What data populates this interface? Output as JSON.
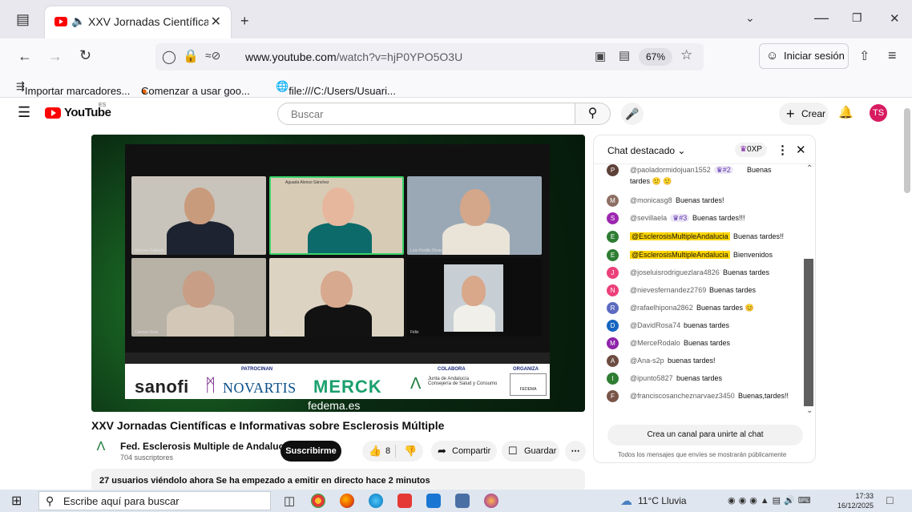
{
  "browser": {
    "tab_title": "XXV Jornadas Científicas e I",
    "url_host": "www.youtube.com",
    "url_path": "/watch?v=hjP0YPO5O3U",
    "zoom": "67%",
    "signin_label": "Iniciar sesión",
    "bookmarks": [
      "Importar marcadores...",
      "Comenzar a usar goo...",
      "file:///C:/Users/Usuari..."
    ]
  },
  "youtube": {
    "logo_text": "YouTube",
    "region": "ES",
    "search_placeholder": "Buscar",
    "create_label": "Crear",
    "avatar_initials": "TS"
  },
  "video": {
    "participants": [
      "Antonio Gallardo",
      "Aguada Alonso Sánchez",
      "Luis Portillo Rivas",
      "Carmen Ruiz",
      "ivonne",
      "Félix"
    ],
    "sponsor_labels": {
      "patrocinan": "PATROCINAN",
      "colabora": "COLABORA",
      "organiza": "ORGANIZA"
    },
    "sponsors": [
      "sanofi",
      "NOVARTIS",
      "MERCK"
    ],
    "junta_text": "Junta de Andalucía",
    "junta_sub": "Consejería de Salud y Consumo",
    "fedema_logo": "FEDEMA",
    "url_banner": "fedema.es"
  },
  "meta": {
    "title": "XXV Jornadas Científicas e Informativas sobre Esclerosis Múltiple",
    "channel": "Fed. Esclerosis Multiple de Andalucia",
    "subscribers": "704 suscriptores",
    "subscribe_label": "Suscribirme",
    "likes": "8",
    "share_label": "Compartir",
    "save_label": "Guardar",
    "info": "27 usuarios viéndolo ahora  Se ha empezado a emitir en directo hace 2 minutos"
  },
  "chat": {
    "title": "Chat destacado",
    "points": "0XP",
    "messages": [
      {
        "author": "@paoladormidojuan1552",
        "badge": "#2",
        "text": "Buenas tardes 🙂 🙂",
        "color": "#5d4037",
        "initial": "P"
      },
      {
        "author": "@monicasg8",
        "text": "Buenas tardes!",
        "color": "#8d6e63",
        "initial": "M"
      },
      {
        "author": "@sevillaela",
        "badge": "#3",
        "text": "Buenas tardes!!!",
        "color": "#9c27b0",
        "initial": "S"
      },
      {
        "author": "@EsclerosisMultipleAndalucia",
        "text": "Buenas tardes!!",
        "color": "#2e7d32",
        "initial": "E",
        "highlight": true
      },
      {
        "author": "@EsclerosisMultipleAndalucia",
        "text": "Bienvenidos",
        "color": "#2e7d32",
        "initial": "E",
        "highlight": true
      },
      {
        "author": "@joseluisrodriguezlara4826",
        "text": "Buenas tardes",
        "color": "#ec407a",
        "initial": "J"
      },
      {
        "author": "@nievesfernandez2769",
        "text": "Buenas tardes",
        "color": "#ec407a",
        "initial": "N"
      },
      {
        "author": "@rafaelhipona2862",
        "text": "Buenas tardes 😊",
        "color": "#5c6bc0",
        "initial": "R"
      },
      {
        "author": "@DavidRosa74",
        "text": "buenas tardes",
        "color": "#1565c0",
        "initial": "D"
      },
      {
        "author": "@MerceRodalo",
        "text": "Buenas tardes",
        "color": "#8e24aa",
        "initial": "M"
      },
      {
        "author": "@Ana-s2p",
        "text": "buenas tardes!",
        "color": "#6d4c41",
        "initial": "A"
      },
      {
        "author": "@ipunto5827",
        "text": "buenas tardes",
        "color": "#2e7d32",
        "initial": "I"
      },
      {
        "author": "@franciscosancheznarvaez3450",
        "text": "Buenas,tardes!!",
        "color": "#795548",
        "initial": "F"
      }
    ],
    "join_label": "Crea un canal para unirte al chat",
    "disclaimer": "Todos los mensajes que envíes se mostrarán públicamente"
  },
  "taskbar": {
    "search_placeholder": "Escribe aquí para buscar",
    "weather": "11°C  Lluvia",
    "time": "17:33",
    "date": "16/12/2025"
  }
}
